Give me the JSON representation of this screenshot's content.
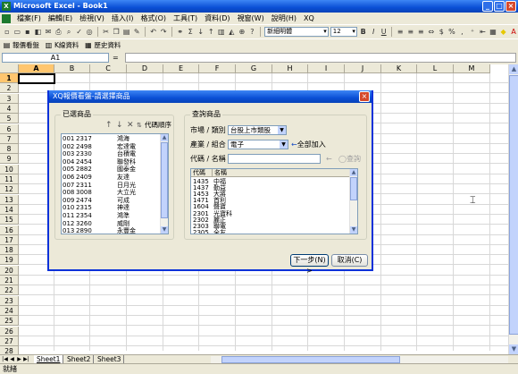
{
  "window": {
    "title": "Microsoft Excel - Book1"
  },
  "menu": [
    "檔案(F)",
    "編輯(E)",
    "檢視(V)",
    "插入(I)",
    "格式(O)",
    "工具(T)",
    "資料(D)",
    "視窗(W)",
    "說明(H)",
    "XQ"
  ],
  "toolbar": {
    "font_name": "新細明體",
    "font_size": "12",
    "bold": "B",
    "italic": "I",
    "underline": "U"
  },
  "toolbar2": {
    "quote": "報價看盤",
    "kline": "K線資料",
    "history": "歷史資料"
  },
  "formula": {
    "cell_ref": "A1",
    "fx": "=",
    "value": ""
  },
  "grid": {
    "columns": [
      "A",
      "B",
      "C",
      "D",
      "E",
      "F",
      "G",
      "H",
      "I",
      "J",
      "K",
      "L",
      "M"
    ],
    "rows": [
      "1",
      "2",
      "3",
      "4",
      "5",
      "6",
      "7",
      "8",
      "9",
      "10",
      "11",
      "12",
      "13",
      "14",
      "15",
      "16",
      "17",
      "18",
      "19",
      "20",
      "21",
      "22",
      "23",
      "24",
      "25",
      "26",
      "27",
      "28"
    ]
  },
  "sheets": [
    "Sheet1",
    "Sheet2",
    "Sheet3"
  ],
  "status": "就緒",
  "dialog": {
    "title": "XQ報價看盤-請選擇商品",
    "selected_group": "已選商品",
    "code_sort": "代碼順序",
    "selected_items": [
      {
        "idx": "001",
        "code": "2317",
        "name": "鴻海"
      },
      {
        "idx": "002",
        "code": "2498",
        "name": "宏達電"
      },
      {
        "idx": "003",
        "code": "2330",
        "name": "台積電"
      },
      {
        "idx": "004",
        "code": "2454",
        "name": "聯發科"
      },
      {
        "idx": "005",
        "code": "2882",
        "name": "國泰金"
      },
      {
        "idx": "006",
        "code": "2409",
        "name": "友達"
      },
      {
        "idx": "007",
        "code": "2311",
        "name": "日月光"
      },
      {
        "idx": "008",
        "code": "3008",
        "name": "大立光"
      },
      {
        "idx": "009",
        "code": "2474",
        "name": "可成"
      },
      {
        "idx": "010",
        "code": "2315",
        "name": "神達"
      },
      {
        "idx": "011",
        "code": "2354",
        "name": "鴻準"
      },
      {
        "idx": "012",
        "code": "3260",
        "name": "威剛"
      },
      {
        "idx": "013",
        "code": "2890",
        "name": "永豐金"
      }
    ],
    "query_group": "查詢商品",
    "market_label": "市場 / 類別",
    "market_value": "台股上市類股",
    "industry_label": "產業 / 組合",
    "industry_value": "電子",
    "add_all": "全部加入",
    "code_name_label": "代碼 / 名稱",
    "code_name_value": "",
    "query_btn": "查詢",
    "results_header": {
      "code": "代碼",
      "name": "名稱"
    },
    "results": [
      {
        "code": "1435",
        "name": "中福"
      },
      {
        "code": "1437",
        "name": "勤益"
      },
      {
        "code": "1453",
        "name": "大將"
      },
      {
        "code": "1471",
        "name": "首利"
      },
      {
        "code": "1604",
        "name": "聲寶"
      },
      {
        "code": "2301",
        "name": "光寶科"
      },
      {
        "code": "2302",
        "name": "麗正"
      },
      {
        "code": "2303",
        "name": "聯電"
      },
      {
        "code": "2305",
        "name": "全友"
      }
    ],
    "next_btn": "下一步(N) >",
    "cancel_btn": "取消(C)"
  }
}
